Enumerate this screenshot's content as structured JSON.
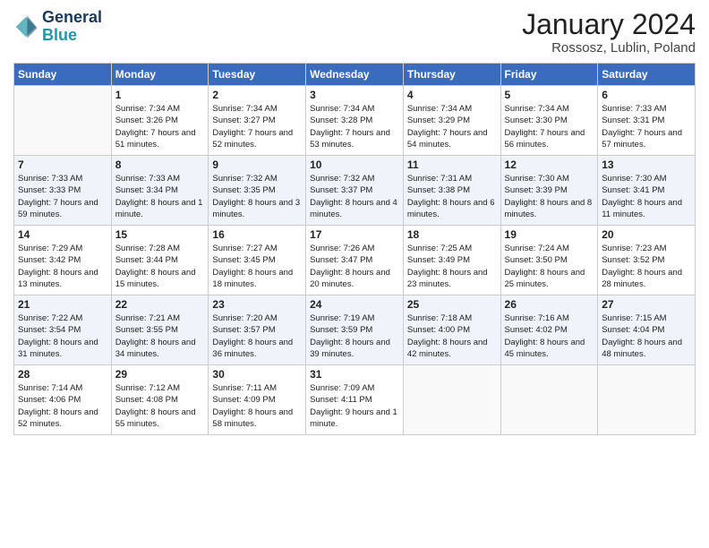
{
  "logo": {
    "text_general": "General",
    "text_blue": "Blue"
  },
  "title": "January 2024",
  "subtitle": "Rossosz, Lublin, Poland",
  "header": {
    "days": [
      "Sunday",
      "Monday",
      "Tuesday",
      "Wednesday",
      "Thursday",
      "Friday",
      "Saturday"
    ]
  },
  "weeks": [
    [
      {
        "day": "",
        "sunrise": "",
        "sunset": "",
        "daylight": ""
      },
      {
        "day": "1",
        "sunrise": "Sunrise: 7:34 AM",
        "sunset": "Sunset: 3:26 PM",
        "daylight": "Daylight: 7 hours and 51 minutes."
      },
      {
        "day": "2",
        "sunrise": "Sunrise: 7:34 AM",
        "sunset": "Sunset: 3:27 PM",
        "daylight": "Daylight: 7 hours and 52 minutes."
      },
      {
        "day": "3",
        "sunrise": "Sunrise: 7:34 AM",
        "sunset": "Sunset: 3:28 PM",
        "daylight": "Daylight: 7 hours and 53 minutes."
      },
      {
        "day": "4",
        "sunrise": "Sunrise: 7:34 AM",
        "sunset": "Sunset: 3:29 PM",
        "daylight": "Daylight: 7 hours and 54 minutes."
      },
      {
        "day": "5",
        "sunrise": "Sunrise: 7:34 AM",
        "sunset": "Sunset: 3:30 PM",
        "daylight": "Daylight: 7 hours and 56 minutes."
      },
      {
        "day": "6",
        "sunrise": "Sunrise: 7:33 AM",
        "sunset": "Sunset: 3:31 PM",
        "daylight": "Daylight: 7 hours and 57 minutes."
      }
    ],
    [
      {
        "day": "7",
        "sunrise": "Sunrise: 7:33 AM",
        "sunset": "Sunset: 3:33 PM",
        "daylight": "Daylight: 7 hours and 59 minutes."
      },
      {
        "day": "8",
        "sunrise": "Sunrise: 7:33 AM",
        "sunset": "Sunset: 3:34 PM",
        "daylight": "Daylight: 8 hours and 1 minute."
      },
      {
        "day": "9",
        "sunrise": "Sunrise: 7:32 AM",
        "sunset": "Sunset: 3:35 PM",
        "daylight": "Daylight: 8 hours and 3 minutes."
      },
      {
        "day": "10",
        "sunrise": "Sunrise: 7:32 AM",
        "sunset": "Sunset: 3:37 PM",
        "daylight": "Daylight: 8 hours and 4 minutes."
      },
      {
        "day": "11",
        "sunrise": "Sunrise: 7:31 AM",
        "sunset": "Sunset: 3:38 PM",
        "daylight": "Daylight: 8 hours and 6 minutes."
      },
      {
        "day": "12",
        "sunrise": "Sunrise: 7:30 AM",
        "sunset": "Sunset: 3:39 PM",
        "daylight": "Daylight: 8 hours and 8 minutes."
      },
      {
        "day": "13",
        "sunrise": "Sunrise: 7:30 AM",
        "sunset": "Sunset: 3:41 PM",
        "daylight": "Daylight: 8 hours and 11 minutes."
      }
    ],
    [
      {
        "day": "14",
        "sunrise": "Sunrise: 7:29 AM",
        "sunset": "Sunset: 3:42 PM",
        "daylight": "Daylight: 8 hours and 13 minutes."
      },
      {
        "day": "15",
        "sunrise": "Sunrise: 7:28 AM",
        "sunset": "Sunset: 3:44 PM",
        "daylight": "Daylight: 8 hours and 15 minutes."
      },
      {
        "day": "16",
        "sunrise": "Sunrise: 7:27 AM",
        "sunset": "Sunset: 3:45 PM",
        "daylight": "Daylight: 8 hours and 18 minutes."
      },
      {
        "day": "17",
        "sunrise": "Sunrise: 7:26 AM",
        "sunset": "Sunset: 3:47 PM",
        "daylight": "Daylight: 8 hours and 20 minutes."
      },
      {
        "day": "18",
        "sunrise": "Sunrise: 7:25 AM",
        "sunset": "Sunset: 3:49 PM",
        "daylight": "Daylight: 8 hours and 23 minutes."
      },
      {
        "day": "19",
        "sunrise": "Sunrise: 7:24 AM",
        "sunset": "Sunset: 3:50 PM",
        "daylight": "Daylight: 8 hours and 25 minutes."
      },
      {
        "day": "20",
        "sunrise": "Sunrise: 7:23 AM",
        "sunset": "Sunset: 3:52 PM",
        "daylight": "Daylight: 8 hours and 28 minutes."
      }
    ],
    [
      {
        "day": "21",
        "sunrise": "Sunrise: 7:22 AM",
        "sunset": "Sunset: 3:54 PM",
        "daylight": "Daylight: 8 hours and 31 minutes."
      },
      {
        "day": "22",
        "sunrise": "Sunrise: 7:21 AM",
        "sunset": "Sunset: 3:55 PM",
        "daylight": "Daylight: 8 hours and 34 minutes."
      },
      {
        "day": "23",
        "sunrise": "Sunrise: 7:20 AM",
        "sunset": "Sunset: 3:57 PM",
        "daylight": "Daylight: 8 hours and 36 minutes."
      },
      {
        "day": "24",
        "sunrise": "Sunrise: 7:19 AM",
        "sunset": "Sunset: 3:59 PM",
        "daylight": "Daylight: 8 hours and 39 minutes."
      },
      {
        "day": "25",
        "sunrise": "Sunrise: 7:18 AM",
        "sunset": "Sunset: 4:00 PM",
        "daylight": "Daylight: 8 hours and 42 minutes."
      },
      {
        "day": "26",
        "sunrise": "Sunrise: 7:16 AM",
        "sunset": "Sunset: 4:02 PM",
        "daylight": "Daylight: 8 hours and 45 minutes."
      },
      {
        "day": "27",
        "sunrise": "Sunrise: 7:15 AM",
        "sunset": "Sunset: 4:04 PM",
        "daylight": "Daylight: 8 hours and 48 minutes."
      }
    ],
    [
      {
        "day": "28",
        "sunrise": "Sunrise: 7:14 AM",
        "sunset": "Sunset: 4:06 PM",
        "daylight": "Daylight: 8 hours and 52 minutes."
      },
      {
        "day": "29",
        "sunrise": "Sunrise: 7:12 AM",
        "sunset": "Sunset: 4:08 PM",
        "daylight": "Daylight: 8 hours and 55 minutes."
      },
      {
        "day": "30",
        "sunrise": "Sunrise: 7:11 AM",
        "sunset": "Sunset: 4:09 PM",
        "daylight": "Daylight: 8 hours and 58 minutes."
      },
      {
        "day": "31",
        "sunrise": "Sunrise: 7:09 AM",
        "sunset": "Sunset: 4:11 PM",
        "daylight": "Daylight: 9 hours and 1 minute."
      },
      {
        "day": "",
        "sunrise": "",
        "sunset": "",
        "daylight": ""
      },
      {
        "day": "",
        "sunrise": "",
        "sunset": "",
        "daylight": ""
      },
      {
        "day": "",
        "sunrise": "",
        "sunset": "",
        "daylight": ""
      }
    ]
  ]
}
